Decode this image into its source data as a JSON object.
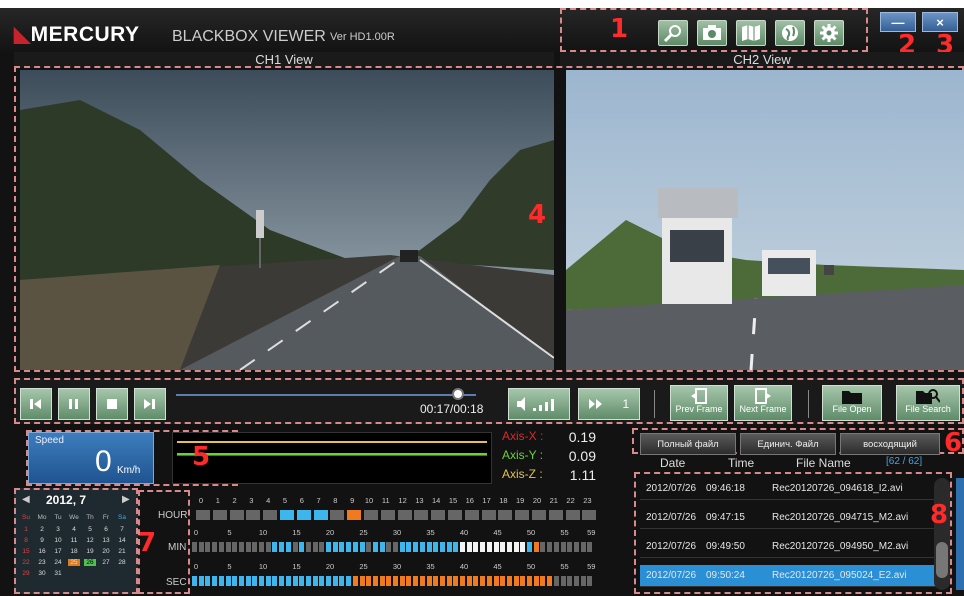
{
  "header": {
    "logo": "MERCURY",
    "subtitle": "BLACKBOX VIEWER",
    "version": "Ver HD1.00R"
  },
  "views": {
    "ch1": "CH1 View",
    "ch2": "CH2 View"
  },
  "callouts": [
    "1",
    "2",
    "3",
    "4",
    "5",
    "6",
    "7",
    "8"
  ],
  "toolbar": {
    "icons": [
      "zoom-search-icon",
      "camera-icon",
      "map-icon",
      "globe-icon",
      "gear-icon"
    ]
  },
  "window": {
    "minimize": "—",
    "close": "×"
  },
  "player": {
    "time": "00:17/00:18",
    "progress": 0.94,
    "volume_icon": "volume-icon",
    "speed": "1",
    "prev_frame": "Prev Frame",
    "next_frame": "Next Frame",
    "file_open": "File Open",
    "file_search": "File Search"
  },
  "speed": {
    "label": "Speed",
    "value": "0",
    "unit": "Km/h"
  },
  "axes": [
    {
      "label": "Axis-X :",
      "value": "0.19",
      "color": "#e0272a"
    },
    {
      "label": "Axis-Y :",
      "value": "0.09",
      "color": "#6ad13d"
    },
    {
      "label": "Axis-Z :",
      "value": "1.11",
      "color": "#e3c14a"
    }
  ],
  "tabs": [
    "Полный файл",
    "Единич. Файл",
    "восходящий"
  ],
  "list": {
    "headers": {
      "date": "Date",
      "time": "Time",
      "filename": "File Name",
      "count": "[62 / 62]"
    },
    "rows": [
      {
        "date": "2012/07/26",
        "time": "09:46:18",
        "file": "Rec20120726_094618_I2.avi",
        "selected": false
      },
      {
        "date": "2012/07/26",
        "time": "09:47:15",
        "file": "Rec20120726_094715_M2.avi",
        "selected": false
      },
      {
        "date": "2012/07/26",
        "time": "09:49:50",
        "file": "Rec20120726_094950_M2.avi",
        "selected": false
      },
      {
        "date": "2012/07/26",
        "time": "09:50:24",
        "file": "Rec20120726_095024_E2.avi",
        "selected": true
      }
    ]
  },
  "calendar": {
    "title": "2012, 7",
    "prev": "◀",
    "next": "▶",
    "weekdays": [
      "Su",
      "Mo",
      "Tu",
      "We",
      "Th",
      "Fr",
      "Sa"
    ],
    "weeks": [
      [
        "1",
        "2",
        "3",
        "4",
        "5",
        "6",
        "7"
      ],
      [
        "8",
        "9",
        "10",
        "11",
        "12",
        "13",
        "14"
      ],
      [
        "15",
        "16",
        "17",
        "18",
        "19",
        "20",
        "21"
      ],
      [
        "22",
        "23",
        "24",
        "25",
        "26",
        "27",
        "28"
      ],
      [
        "29",
        "30",
        "31",
        "",
        "",
        "",
        ""
      ]
    ]
  },
  "timeline": {
    "labels": {
      "hour": "HOUR",
      "min": "MIN",
      "sec": "SEC"
    },
    "hour_ticks": [
      "0",
      "1",
      "2",
      "3",
      "4",
      "5",
      "6",
      "7",
      "8",
      "9",
      "10",
      "11",
      "12",
      "13",
      "14",
      "15",
      "16",
      "17",
      "18",
      "19",
      "20",
      "21",
      "22",
      "23"
    ],
    "minsec_ticks": [
      "0",
      "5",
      "10",
      "15",
      "20",
      "25",
      "30",
      "35",
      "40",
      "45",
      "50",
      "55",
      "59"
    ]
  }
}
